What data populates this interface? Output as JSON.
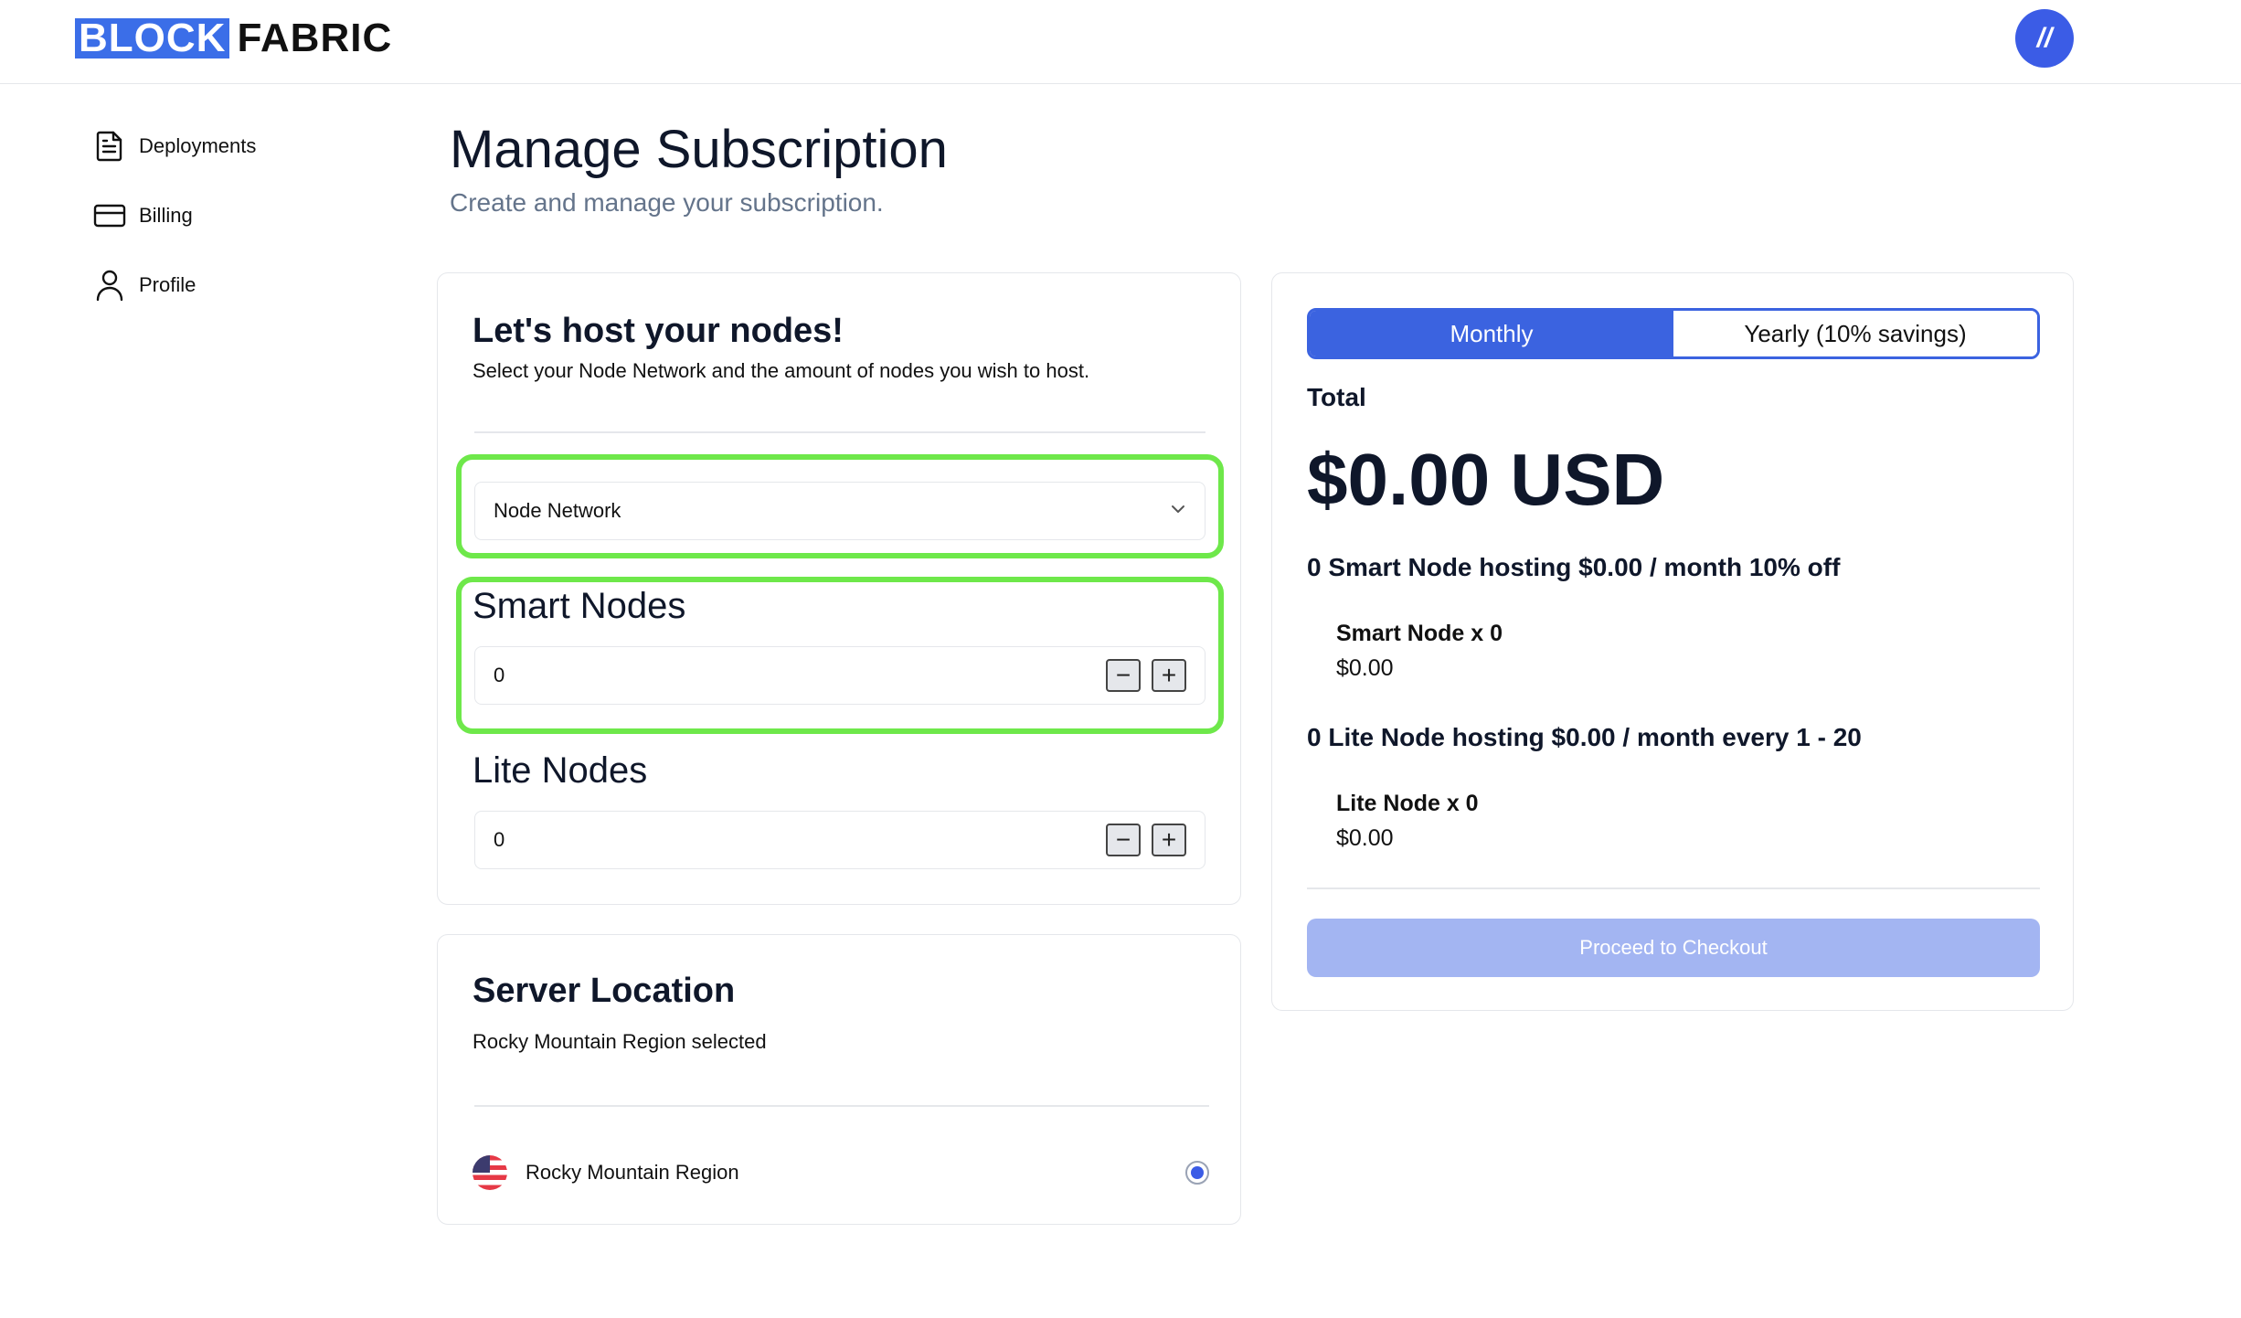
{
  "header": {
    "logo_block": "BLOCK",
    "logo_fabric": "FABRIC",
    "avatar_text": "//"
  },
  "sidebar": {
    "items": [
      {
        "label": "Deployments",
        "icon": "document-icon"
      },
      {
        "label": "Billing",
        "icon": "credit-card-icon"
      },
      {
        "label": "Profile",
        "icon": "user-icon"
      }
    ]
  },
  "page": {
    "title": "Manage Subscription",
    "subtitle": "Create and manage your subscription."
  },
  "host_card": {
    "title": "Let's host your nodes!",
    "description": "Select your Node Network and the amount of nodes you wish to host.",
    "network_select": {
      "value": "Node Network"
    },
    "smart_nodes": {
      "label": "Smart Nodes",
      "value": "0"
    },
    "lite_nodes": {
      "label": "Lite Nodes",
      "value": "0"
    },
    "minus_symbol": "−",
    "plus_symbol": "+"
  },
  "location_card": {
    "title": "Server Location",
    "description": "Rocky Mountain Region selected",
    "option": {
      "label": "Rocky Mountain Region",
      "selected": true
    }
  },
  "summary": {
    "toggle": {
      "monthly": "Monthly",
      "yearly": "Yearly (10% savings)",
      "active": "monthly"
    },
    "total_label": "Total",
    "total_amount": "$0.00 USD",
    "smart_line": "0 Smart Node hosting $0.00 / month 10% off",
    "smart_item": "Smart Node x 0",
    "smart_price": "$0.00",
    "lite_line": "0 Lite Node hosting $0.00 / month every 1 - 20",
    "lite_item": "Lite Node x 0",
    "lite_price": "$0.00",
    "checkout_label": "Proceed to Checkout"
  },
  "colors": {
    "accent": "#3b63e0",
    "highlight": "#6ee84a",
    "checkout_disabled": "#a3b5f2"
  }
}
